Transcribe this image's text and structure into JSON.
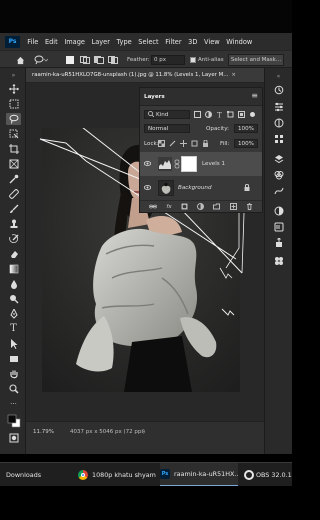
{
  "menubar": {
    "logo": "Ps",
    "items": [
      "File",
      "Edit",
      "Image",
      "Layer",
      "Type",
      "Select",
      "Filter",
      "3D",
      "View",
      "Window"
    ]
  },
  "options": {
    "feather_label": "Feather:",
    "feather_value": "0 px",
    "antialias_label": "Anti-alias",
    "select_mask_label": "Select and Mask..."
  },
  "document": {
    "tab_title": "raamin-ka-uR51HXLO7G8-unsplash (1).jpg @ 11.8% (Levels 1, Layer M...",
    "close_glyph": "×"
  },
  "status": {
    "zoom": "11.79%",
    "info": "4037 px x 5046 px (72 ppi)",
    "caret": "›"
  },
  "layers_panel": {
    "title": "Layers",
    "kind_label": "Kind",
    "blend_mode": "Normal",
    "opacity_label": "Opacity:",
    "opacity_value": "100%",
    "lock_label": "Lock:",
    "fill_label": "Fill:",
    "fill_value": "100%",
    "layers": [
      {
        "name": "Levels 1",
        "selected": true
      },
      {
        "name": "Background",
        "selected": false
      }
    ],
    "footer_fx": "fx"
  },
  "taskbar": {
    "items": [
      {
        "label": "Downloads"
      },
      {
        "label": "1080p khatu shyam ..."
      },
      {
        "label": "raamin-ka-uR51HX..."
      },
      {
        "label": "OBS 32.0.1"
      }
    ],
    "ps_icon_text": "Ps"
  },
  "colors": {
    "ui_dark": "#2a2a2a",
    "panel": "#383838",
    "ps_blue": "#31a8ff",
    "selected_row": "#4c4c4c"
  }
}
